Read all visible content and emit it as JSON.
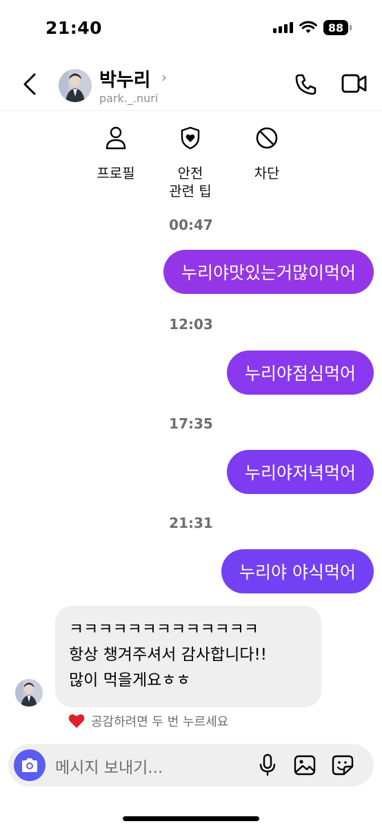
{
  "status_bar": {
    "time": "21:40",
    "battery": "88"
  },
  "header": {
    "name": "박누리",
    "handle": "park._.nuri"
  },
  "actions": {
    "profile": "프로필",
    "safety_line1": "안전",
    "safety_line2": "관련 팁",
    "block": "차단"
  },
  "messages": [
    {
      "time": "00:47",
      "text": "누리야맛있는거많이먹어"
    },
    {
      "time": "12:03",
      "text": "누리야점심먹어"
    },
    {
      "time": "17:35",
      "text": "누리야저녁먹어"
    },
    {
      "time": "21:31",
      "text": "누리야 야식먹어"
    }
  ],
  "incoming": {
    "line1": "ㅋㅋㅋㅋㅋㅋㅋㅋㅋㅋㅋㅋㅋ",
    "line2": "항상 챙겨주셔서 감사합니다!!",
    "line3": "많이 먹을게요ㅎㅎ"
  },
  "reaction_hint": "공감하려면 두 번 누르세요",
  "composer": {
    "placeholder": "메시지 보내기..."
  },
  "colors": {
    "bubble_top": "#9436e8",
    "bubble_bottom": "#7340f3",
    "camera": "#5b5cf0"
  }
}
